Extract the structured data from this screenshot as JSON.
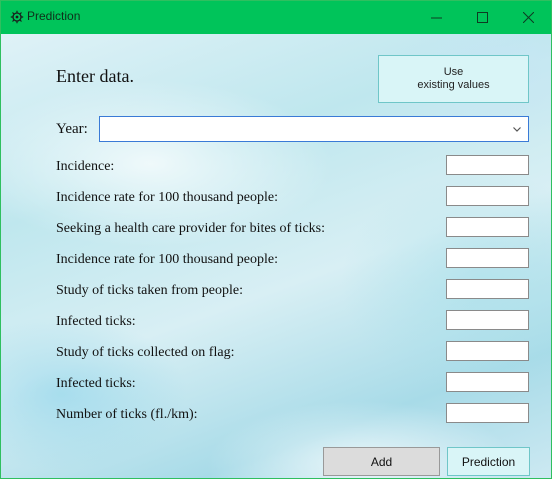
{
  "window": {
    "title": "Prediction",
    "icon": "gear-bug-icon",
    "controls": {
      "minimize": "minimize-icon",
      "maximize": "maximize-icon",
      "close": "close-icon"
    }
  },
  "form": {
    "heading": "Enter data.",
    "use_existing_line1": "Use",
    "use_existing_line2": "existing values",
    "year_label": "Year:",
    "year_value": "",
    "fields": [
      {
        "label": "Incidence:",
        "value": ""
      },
      {
        "label": "Incidence rate for 100 thousand people:",
        "value": ""
      },
      {
        "label": "Seeking a health care provider for bites of ticks:",
        "value": ""
      },
      {
        "label": "Incidence rate for 100 thousand people:",
        "value": ""
      },
      {
        "label": "Study of ticks taken from people:",
        "value": ""
      },
      {
        "label": "Infected ticks:",
        "value": ""
      },
      {
        "label": "Study of ticks collected on flag:",
        "value": ""
      },
      {
        "label": "Infected ticks:",
        "value": ""
      },
      {
        "label": "Number of ticks (fl./km):",
        "value": ""
      }
    ],
    "add_label": "Add",
    "prediction_label": "Prediction"
  },
  "colors": {
    "titlebar": "#00c45a",
    "accent_button": "#d9f5f7",
    "focus_border": "#3a7ad6"
  }
}
